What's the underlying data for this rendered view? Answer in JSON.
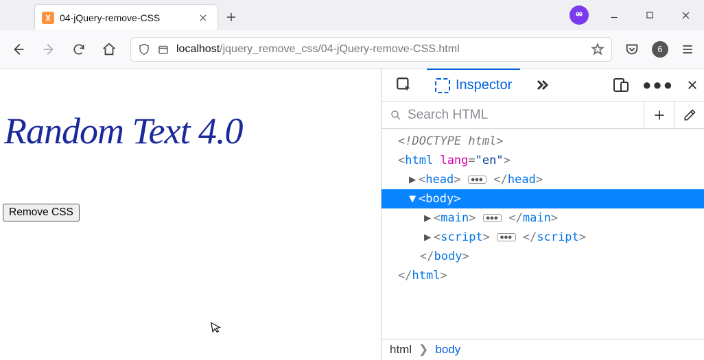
{
  "tabstrip": {
    "tabs": [
      {
        "title": "04-jQuery-remove-CSS"
      }
    ]
  },
  "urlbar": {
    "host": "localhost",
    "rest": "/jquery_remove_css/04-jQuery-remove-CSS.html"
  },
  "toolbar": {
    "badge_count": "6"
  },
  "page": {
    "heading": "Random Text 4.0",
    "button_label": "Remove CSS"
  },
  "devtools": {
    "active_tab": "Inspector",
    "search_placeholder": "Search HTML",
    "tree": {
      "doctype": "<!DOCTYPE html>",
      "html_open": "html",
      "html_lang_attr": "lang",
      "html_lang_val": "\"en\"",
      "head": "head",
      "body": "body",
      "main": "main",
      "script": "script",
      "body_close": "body",
      "html_close": "html"
    },
    "breadcrumb": {
      "root": "html",
      "sel": "body"
    }
  }
}
